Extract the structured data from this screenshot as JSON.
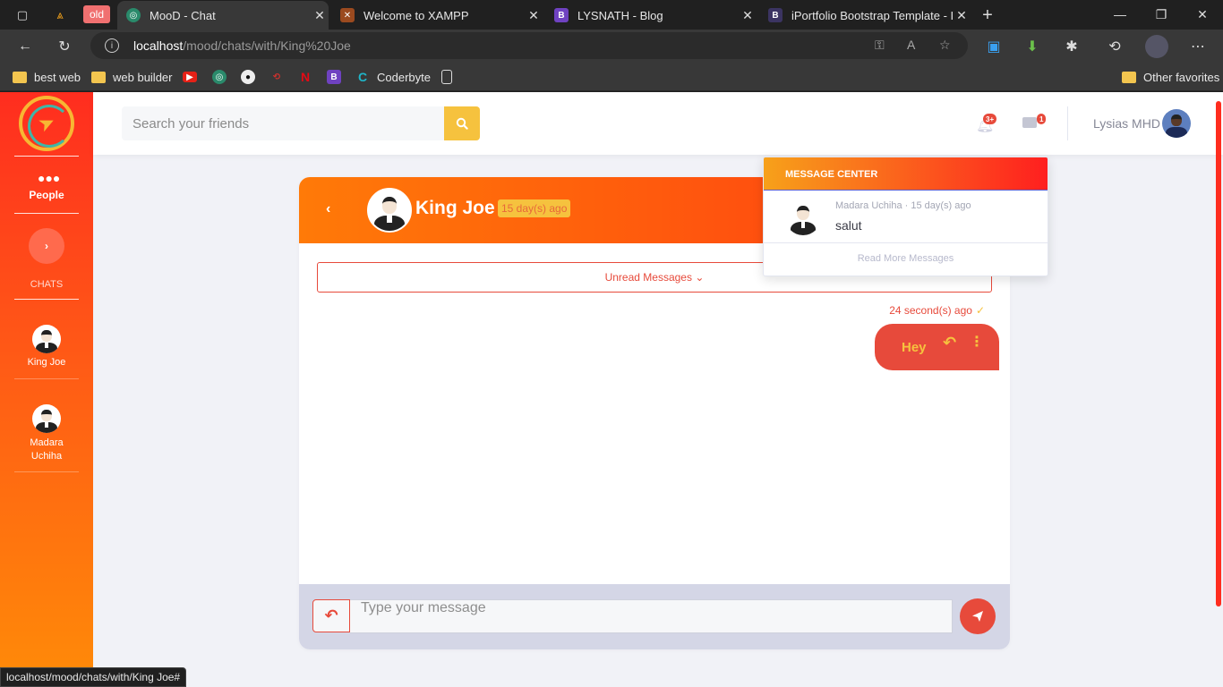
{
  "browser": {
    "old_tag": "old",
    "tabs": [
      {
        "title": "MooD - Chat",
        "active": true
      },
      {
        "title": "Welcome to XAMPP",
        "active": false
      },
      {
        "title": "LYSNATH - Blog",
        "active": false
      },
      {
        "title": "iPortfolio Bootstrap Template - In",
        "active": false
      }
    ],
    "url_host": "localhost",
    "url_path": "/mood/chats/with/King%20Joe",
    "bookmarks": [
      "best web",
      "web builder",
      "Coderbyte"
    ],
    "other_favorites": "Other favorites",
    "status_url": "localhost/mood/chats/with/King Joe#"
  },
  "sidebar": {
    "people_label": "People",
    "chats_label": "CHATS",
    "contacts": [
      "King Joe",
      "Madara Uchiha"
    ]
  },
  "topbar": {
    "search_placeholder": "Search your friends",
    "alerts_badge": "3+",
    "messages_badge": "1",
    "username": "Lysias MHD"
  },
  "chat": {
    "name": "King Joe",
    "last_seen": "15 day(s) ago",
    "unread_label": "Unread Messages",
    "messages": [
      {
        "text": "Hey",
        "time": "24 second(s) ago",
        "outgoing": true
      }
    ],
    "input_placeholder": "Type your message"
  },
  "message_center": {
    "title": "MESSAGE CENTER",
    "items": [
      {
        "sender_meta": "Madara Uchiha · 15 day(s) ago",
        "text": "salut"
      }
    ],
    "read_more": "Read More Messages"
  },
  "colors": {
    "accent_red": "#e74a3b",
    "accent_yellow": "#f6c23e",
    "sidebar_top": "#ff2d1f",
    "sidebar_bottom": "#ff8b08"
  }
}
